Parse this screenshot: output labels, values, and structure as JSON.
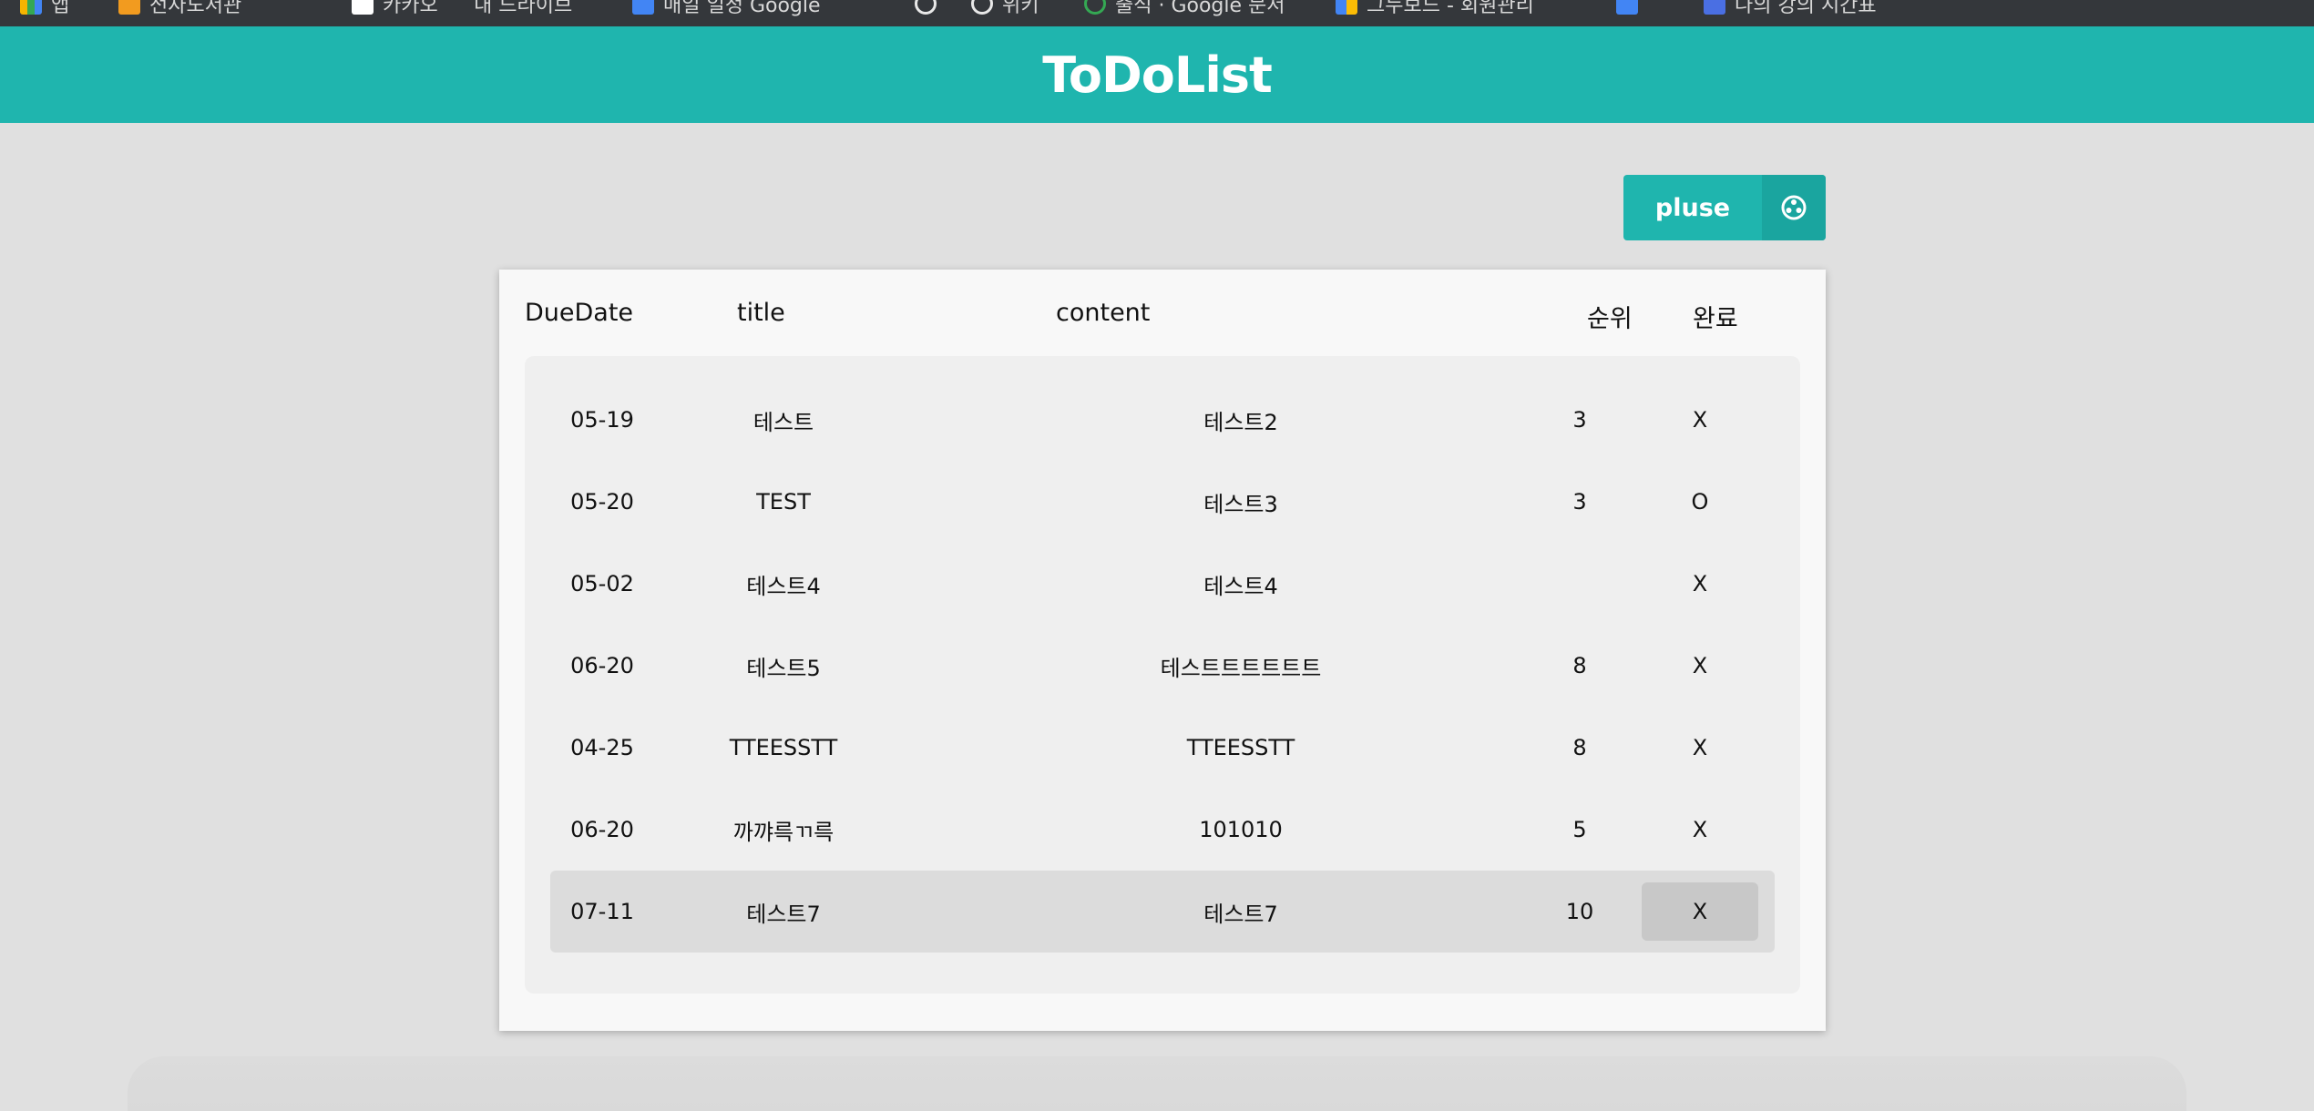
{
  "bookmarks": [
    {
      "label": "앱",
      "color": "#f4b400"
    },
    {
      "label": "전자도서관",
      "color": "#f29b1f"
    },
    {
      "label": "카카오",
      "color": "#ffffff"
    },
    {
      "label": "내 드라이브",
      "color": "#ffffff"
    },
    {
      "label": "매일 일정 Google",
      "color": "#4285f4"
    },
    {
      "label": "",
      "color": ""
    },
    {
      "label": "위키",
      "color": ""
    },
    {
      "label": "출석 · Google 문서",
      "color": "#34a853"
    },
    {
      "label": "그누보드 - 회원관리",
      "color": "#fbbc05"
    },
    {
      "label": "",
      "color": "#4285f4"
    },
    {
      "label": "나의 강의 시간표",
      "color": "#4a6fe3"
    }
  ],
  "header": {
    "title": "ToDoList"
  },
  "toolbar": {
    "plus_label": "pluse",
    "plus_icon": "gear-icon"
  },
  "table": {
    "columns": [
      "DueDate",
      "title",
      "content",
      "순위",
      "완료"
    ],
    "rows": [
      {
        "date": "05-19",
        "title": "테스트",
        "content": "테스트2",
        "rank": "3",
        "done": "X"
      },
      {
        "date": "05-20",
        "title": "TEST",
        "content": "테스트3",
        "rank": "3",
        "done": "O"
      },
      {
        "date": "05-02",
        "title": "테스트4",
        "content": "테스트4",
        "rank": "",
        "done": "X"
      },
      {
        "date": "06-20",
        "title": "테스트5",
        "content": "테스트트트트트트",
        "rank": "8",
        "done": "X"
      },
      {
        "date": "04-25",
        "title": "TTEESSTT",
        "content": "TTEESSTT",
        "rank": "8",
        "done": "X"
      },
      {
        "date": "06-20",
        "title": "까꺄륵ㄲ륵",
        "content": "101010",
        "rank": "5",
        "done": "X"
      },
      {
        "date": "07-11",
        "title": "테스트7",
        "content": "테스트7",
        "rank": "10",
        "done": "X"
      }
    ]
  },
  "colors": {
    "accent": "#1fb5ae",
    "accent_dark": "#1aa59f",
    "background": "#e0e0e0"
  }
}
